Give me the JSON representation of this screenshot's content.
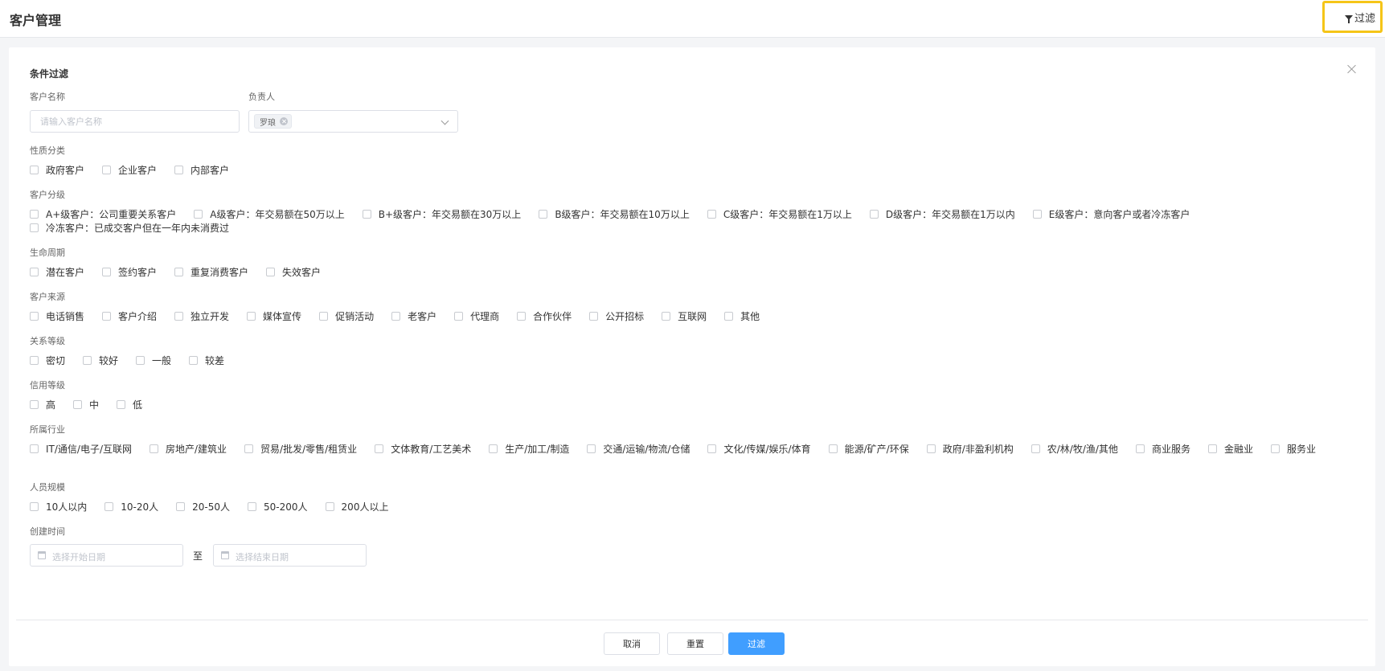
{
  "header": {
    "title": "客户管理",
    "filter_label": "过滤"
  },
  "panel": {
    "title": "条件过滤"
  },
  "fields": {
    "customer_name": {
      "label": "客户名称",
      "placeholder": "请输入客户名称"
    },
    "owner": {
      "label": "负责人",
      "tag": "罗琅"
    }
  },
  "groups": {
    "nature": {
      "label": "性质分类",
      "options": [
        "政府客户",
        "企业客户",
        "内部客户"
      ]
    },
    "level": {
      "label": "客户分级",
      "options": [
        "A+级客户：公司重要关系客户",
        "A级客户：年交易额在50万以上",
        "B+级客户：年交易额在30万以上",
        "B级客户：年交易额在10万以上",
        "C级客户：年交易额在1万以上",
        "D级客户：年交易额在1万以内",
        "E级客户：意向客户或者冷冻客户",
        "冷冻客户：已成交客户但在一年内未消费过"
      ]
    },
    "lifecycle": {
      "label": "生命周期",
      "options": [
        "潜在客户",
        "签约客户",
        "重复消费客户",
        "失效客户"
      ]
    },
    "source": {
      "label": "客户来源",
      "options": [
        "电话销售",
        "客户介绍",
        "独立开发",
        "媒体宣传",
        "促销活动",
        "老客户",
        "代理商",
        "合作伙伴",
        "公开招标",
        "互联网",
        "其他"
      ]
    },
    "relation": {
      "label": "关系等级",
      "options": [
        "密切",
        "较好",
        "一般",
        "较差"
      ]
    },
    "credit": {
      "label": "信用等级",
      "options": [
        "高",
        "中",
        "低"
      ]
    },
    "industry": {
      "label": "所属行业",
      "options": [
        "IT/通信/电子/互联网",
        "房地产/建筑业",
        "贸易/批发/零售/租赁业",
        "文体教育/工艺美术",
        "生产/加工/制造",
        "交通/运输/物流/仓储",
        "文化/传媒/娱乐/体育",
        "能源/矿产/环保",
        "政府/非盈利机构",
        "农/林/牧/渔/其他",
        "商业服务",
        "金融业",
        "服务业"
      ]
    },
    "staff": {
      "label": "人员规模",
      "options": [
        "10人以内",
        "10-20人",
        "20-50人",
        "50-200人",
        "200人以上"
      ]
    }
  },
  "created": {
    "label": "创建时间",
    "start_placeholder": "选择开始日期",
    "to": "至",
    "end_placeholder": "选择结束日期"
  },
  "footer": {
    "cancel": "取消",
    "reset": "重置",
    "filter": "过滤"
  }
}
